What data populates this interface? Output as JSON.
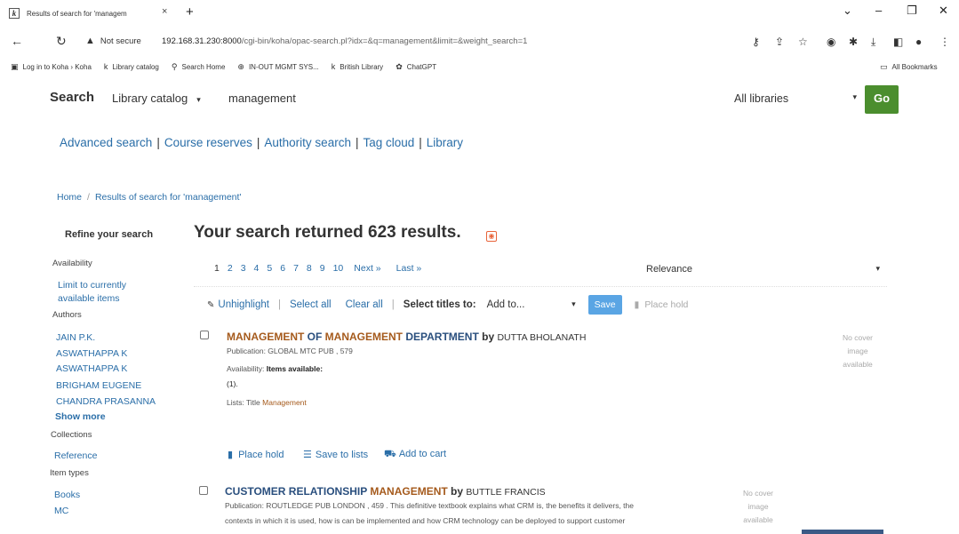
{
  "browser": {
    "tab_title": "Results of search for 'managem",
    "tab_close": "×",
    "new_tab": "+",
    "not_secure": "Not secure",
    "url_host": "192.168.31.230:8000",
    "url_path": "/cgi-bin/koha/opac-search.pl?idx=&q=management&limit=&weight_search=1",
    "bookmarks": [
      {
        "label": "Log in to Koha › Koha",
        "icon": "koha-icon"
      },
      {
        "label": "Library catalog",
        "icon": "koha-icon"
      },
      {
        "label": "Search Home",
        "icon": "search-icon"
      },
      {
        "label": "IN-OUT MGMT SYS...",
        "icon": "globe-icon"
      },
      {
        "label": "British Library",
        "icon": "koha-icon"
      },
      {
        "label": "ChatGPT",
        "icon": "chatgpt-icon"
      }
    ],
    "all_bookmarks": "All Bookmarks"
  },
  "masthead": {
    "search_label": "Search",
    "catalog_select": "Library catalog",
    "query": "management",
    "library_select": "All libraries",
    "go": "Go"
  },
  "nav_links": [
    "Advanced search",
    "Course reserves",
    "Authority search",
    "Tag cloud",
    "Library"
  ],
  "breadcrumb": {
    "home": "Home",
    "current": "Results of search for 'management'"
  },
  "sidebar": {
    "refine": "Refine your search",
    "availability_heading": "Availability",
    "availability_link_1": "Limit to currently",
    "availability_link_2": "available items",
    "authors_heading": "Authors",
    "authors": [
      "JAIN P.K.",
      "ASWATHAPPA K",
      "ASWATHAPPA K",
      "BRIGHAM EUGENE",
      "CHANDRA PRASANNA"
    ],
    "show_more": "Show more",
    "collections_heading": "Collections",
    "collections": [
      "Reference"
    ],
    "item_types_heading": "Item types",
    "item_types": [
      "Books",
      "MC"
    ]
  },
  "results": {
    "summary": "Your search returned 623 results.",
    "pages": [
      "1",
      "2",
      "3",
      "4",
      "5",
      "6",
      "7",
      "8",
      "9",
      "10",
      "Next »",
      "Last »"
    ],
    "sort": "Relevance",
    "toolbar": {
      "unhighlight": "Unhighlight",
      "select_all": "Select all",
      "clear_all": "Clear all",
      "select_titles": "Select titles to:",
      "add_to": "Add to...",
      "save": "Save",
      "place_hold": "Place hold"
    },
    "record1": {
      "title_a": "MANAGEMENT",
      "title_b": " OF ",
      "title_c": "MANAGEMENT",
      "title_d": " DEPARTMENT",
      "by": " by ",
      "author": "DUTTA BHOLANATH",
      "publication": "Publication: GLOBAL MTC PUB , 579",
      "availability_label": "Availability: ",
      "availability_value": "Items available:",
      "count": "(1).",
      "lists_label": "Lists: Title ",
      "lists_link": "Management",
      "no_image_1": "No cover",
      "no_image_2": "image",
      "no_image_3": "available",
      "place_hold": "Place hold",
      "save_to_lists": "Save to lists",
      "add_to_cart": "Add to cart"
    },
    "record2": {
      "title_a": "CUSTOMER RELATIONSHIP ",
      "title_b": "MANAGEMENT",
      "by": " by ",
      "author": "BUTTLE FRANCIS",
      "summary_1": "Publication: ROUTLEDGE PUB LONDON , 459 . This definitive textbook explains what CRM is, the benefits it delivers, the",
      "summary_2": "contexts in which it is used, how is can be implemented and how CRM technology can be deployed to support customer",
      "no_image_1": "No cover",
      "no_image_2": "image",
      "no_image_3": "available"
    }
  }
}
